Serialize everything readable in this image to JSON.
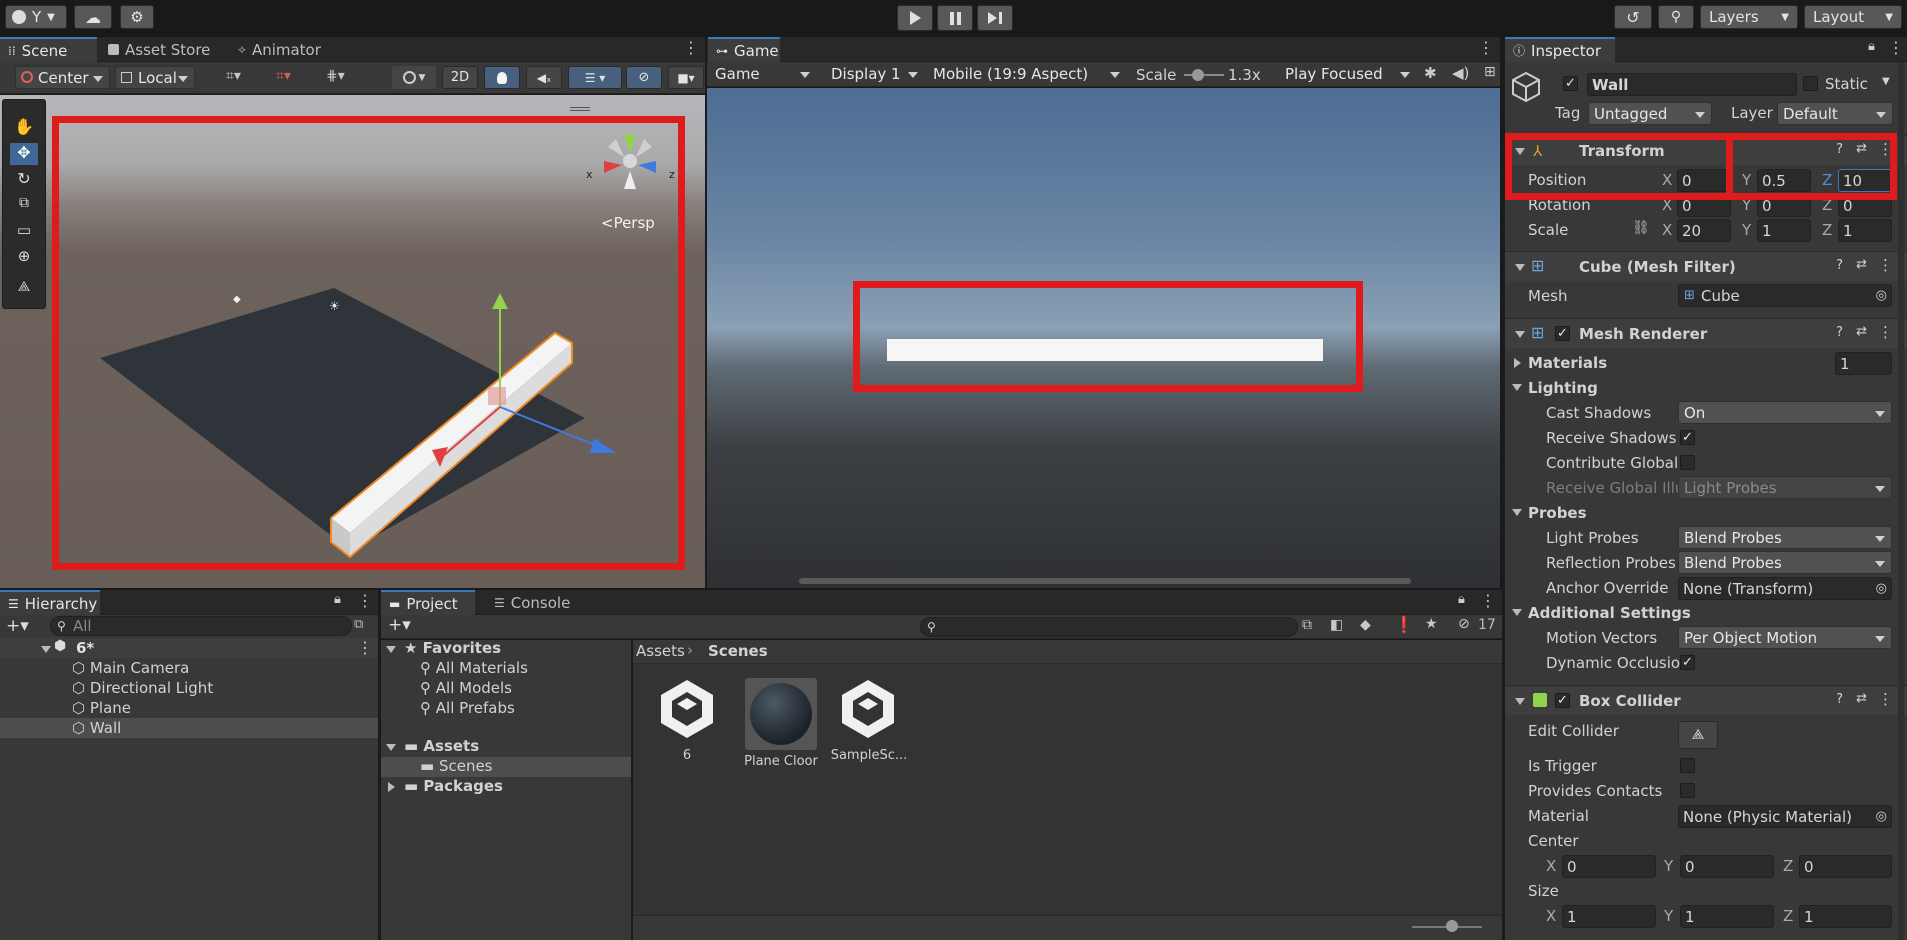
{
  "toolbar": {
    "account_label": "Y",
    "layers_label": "Layers",
    "layout_label": "Layout"
  },
  "scene_panel": {
    "tabs": [
      "Scene",
      "Asset Store",
      "Animator"
    ],
    "pivot_label": "Center",
    "space_label": "Local",
    "mode_2d": "2D",
    "persp_label": "<Persp",
    "gizmo_x": "x",
    "gizmo_z": "z"
  },
  "game_panel": {
    "tab": "Game",
    "game_select": "Game",
    "display_select": "Display 1",
    "aspect_select": "Mobile (19:9 Aspect)",
    "scale_label": "Scale",
    "scale_value": "1.3x",
    "play_focused": "Play Focused"
  },
  "hierarchy": {
    "tab": "Hierarchy",
    "search_placeholder": "All",
    "scene_name": "6*",
    "items": [
      "Main Camera",
      "Directional Light",
      "Plane",
      "Wall"
    ]
  },
  "project": {
    "tabs": [
      "Project",
      "Console"
    ],
    "favorites_label": "Favorites",
    "favorites": [
      "All Materials",
      "All Models",
      "All Prefabs"
    ],
    "assets_label": "Assets",
    "scenes_label": "Scenes",
    "packages_label": "Packages",
    "breadcrumb": [
      "Assets",
      "Scenes"
    ],
    "hidden_count": "17",
    "files": [
      "6",
      "Plane Cloor",
      "SampleSc..."
    ]
  },
  "inspector": {
    "tab": "Inspector",
    "object_name": "Wall",
    "static_label": "Static",
    "tag_label": "Tag",
    "tag_value": "Untagged",
    "layer_label": "Layer",
    "layer_value": "Default",
    "transform": {
      "title": "Transform",
      "position_label": "Position",
      "rotation_label": "Rotation",
      "scale_label": "Scale",
      "position": {
        "x": "0",
        "y": "0.5",
        "z": "10"
      },
      "rotation": {
        "x": "0",
        "y": "0",
        "z": "0"
      },
      "scale": {
        "x": "20",
        "y": "1",
        "z": "1"
      }
    },
    "mesh_filter": {
      "title": "Cube (Mesh Filter)",
      "mesh_label": "Mesh",
      "mesh_value": "Cube"
    },
    "mesh_renderer": {
      "title": "Mesh Renderer",
      "materials_label": "Materials",
      "materials_count": "1",
      "lighting_label": "Lighting",
      "cast_shadows_label": "Cast Shadows",
      "cast_shadows_value": "On",
      "receive_shadows_label": "Receive Shadows",
      "contribute_global_label": "Contribute Global",
      "receive_global_label": "Receive Global Illu",
      "receive_global_value": "Light Probes",
      "probes_label": "Probes",
      "light_probes_label": "Light Probes",
      "light_probes_value": "Blend Probes",
      "reflection_probes_label": "Reflection Probes",
      "reflection_probes_value": "Blend Probes",
      "anchor_override_label": "Anchor Override",
      "anchor_override_value": "None (Transform)",
      "additional_label": "Additional Settings",
      "motion_vectors_label": "Motion Vectors",
      "motion_vectors_value": "Per Object Motion",
      "dynamic_occlusion_label": "Dynamic Occlusio"
    },
    "box_collider": {
      "title": "Box Collider",
      "edit_collider_label": "Edit Collider",
      "is_trigger_label": "Is Trigger",
      "provides_contacts_label": "Provides Contacts",
      "material_label": "Material",
      "material_value": "None (Physic Material)",
      "center_label": "Center",
      "center": {
        "x": "0",
        "y": "0",
        "z": "0"
      },
      "size_label": "Size",
      "size": {
        "x": "1",
        "y": "1",
        "z": "1"
      }
    },
    "axis_x": "X",
    "axis_y": "Y",
    "axis_z": "Z"
  },
  "colors": {
    "highlight_red": "#e01b1b",
    "selection_blue": "#3a79bb",
    "panel_bg": "#383838"
  }
}
